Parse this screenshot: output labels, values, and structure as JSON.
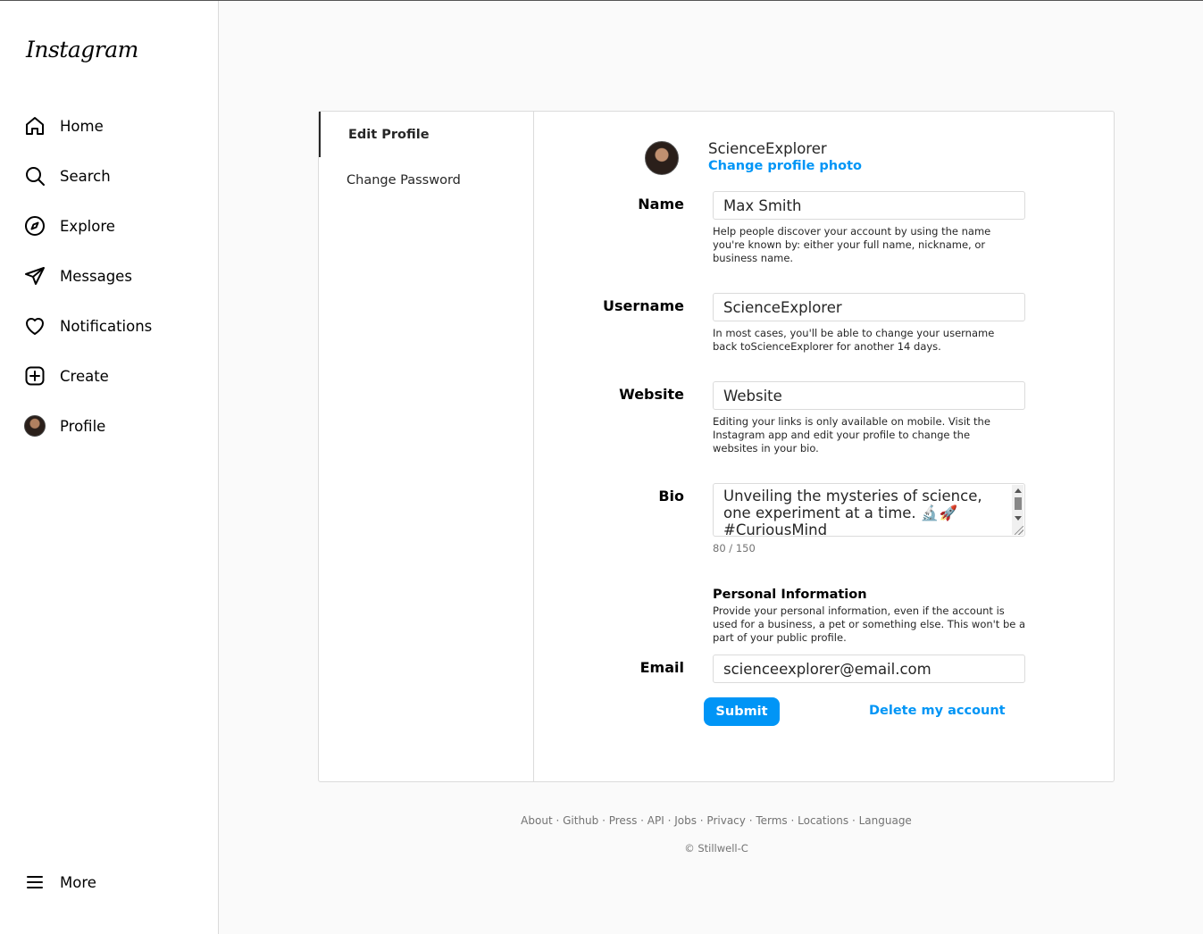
{
  "app": {
    "logo": "Instagram"
  },
  "sidebar": {
    "items": [
      {
        "label": "Home",
        "icon": "home-icon"
      },
      {
        "label": "Search",
        "icon": "search-icon"
      },
      {
        "label": "Explore",
        "icon": "compass-icon"
      },
      {
        "label": "Messages",
        "icon": "send-icon"
      },
      {
        "label": "Notifications",
        "icon": "heart-icon"
      },
      {
        "label": "Create",
        "icon": "plus-square-icon"
      },
      {
        "label": "Profile",
        "icon": "avatar"
      }
    ],
    "more": {
      "label": "More",
      "icon": "menu-icon"
    }
  },
  "settings": {
    "tabs": [
      {
        "label": "Edit Profile",
        "active": true
      },
      {
        "label": "Change Password",
        "active": false
      }
    ],
    "profile": {
      "username": "ScienceExplorer",
      "change_photo": "Change profile photo"
    },
    "fields": {
      "name": {
        "label": "Name",
        "value": "Max Smith",
        "help": "Help people discover your account by using the name you're known by: either your full name, nickname, or business name."
      },
      "username": {
        "label": "Username",
        "value": "ScienceExplorer",
        "help": "In most cases, you'll be able to change your username back toScienceExplorer for another 14 days."
      },
      "website": {
        "label": "Website",
        "value": "Website",
        "help": "Editing your links is only available on mobile. Visit the Instagram app and edit your profile to change the websites in your bio."
      },
      "bio": {
        "label": "Bio",
        "value": "Unveiling the mysteries of science, one experiment at a time. 🔬🚀 #CuriousMind",
        "counter": "80 / 150"
      },
      "personal_info": {
        "title": "Personal Information",
        "help": "Provide your personal information, even if the account is used for a business, a pet or something else. This won't be a part of your public profile."
      },
      "email": {
        "label": "Email",
        "value": "scienceexplorer@email.com"
      }
    },
    "submit_label": "Submit",
    "delete_label": "Delete my account"
  },
  "footer": {
    "links": [
      "About",
      "Github",
      "Press",
      "API",
      "Jobs",
      "Privacy",
      "Terms",
      "Locations",
      "Language"
    ],
    "separator": " · ",
    "copyright": "© Stillwell-C"
  },
  "colors": {
    "accent": "#0095f6",
    "border": "#dbdbdb",
    "muted": "#737373"
  }
}
